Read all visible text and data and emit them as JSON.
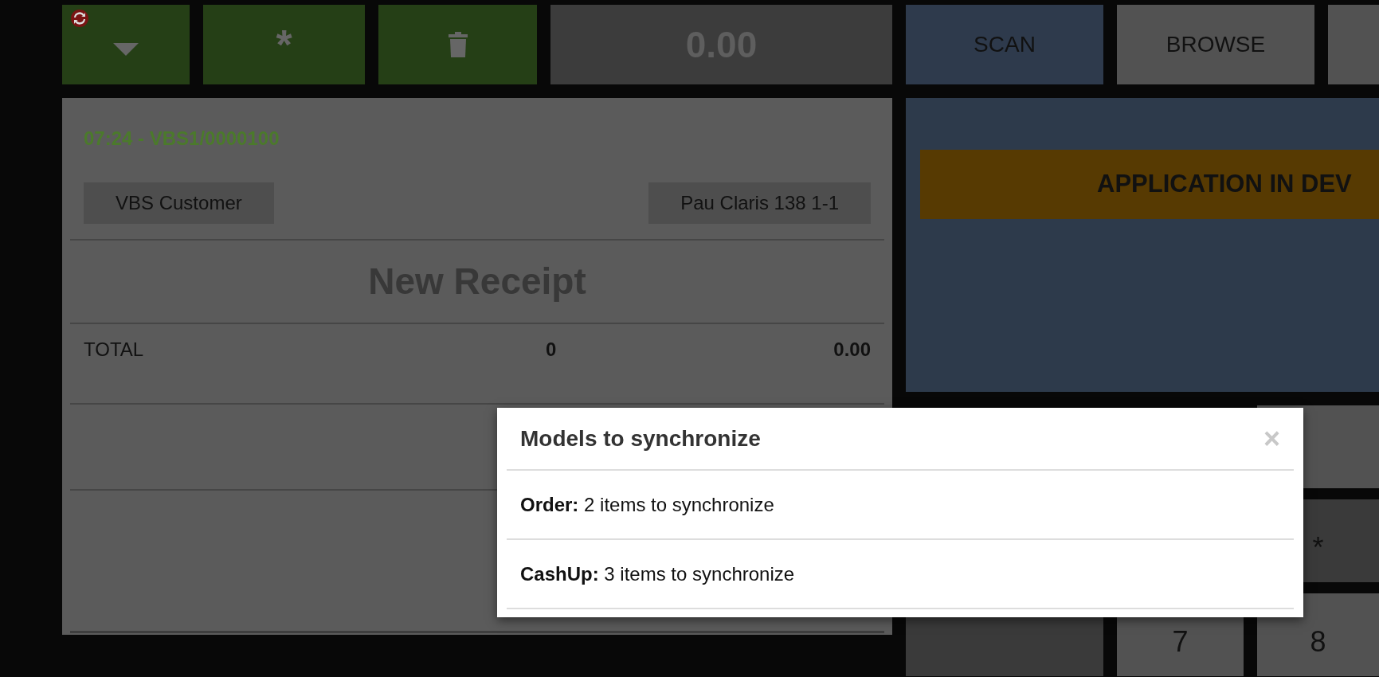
{
  "toolbar": {
    "buttons": [
      {
        "kind": "menu",
        "badge": true
      },
      {
        "kind": "text",
        "label": "*"
      },
      {
        "kind": "delete"
      }
    ],
    "total": "0.00"
  },
  "receipt": {
    "header": "07:24 - VBS1/0000100",
    "customer": "VBS Customer",
    "address": "Pau Claris 138 1-1",
    "title": "New Receipt",
    "total_row": {
      "label": "TOTAL",
      "quantity": "0",
      "amount": "0.00"
    }
  },
  "tabs": [
    {
      "label": "SCAN",
      "selected": true
    },
    {
      "label": "BROWSE",
      "selected": false
    },
    {
      "selected": false
    }
  ],
  "banner": "APPLICATION IN DEV",
  "keypad_rows": [
    [
      {
        "kind": "plain"
      }
    ],
    [
      {
        "kind": "dark",
        "label": "*"
      }
    ],
    [
      {
        "kind": "dark"
      },
      {
        "kind": "plain",
        "label": "7"
      },
      {
        "kind": "plain",
        "label": "8"
      }
    ]
  ],
  "modal": {
    "title": "Models to synchronize",
    "close": "×",
    "items": [
      "**Order:** 2 items to synchronize",
      "**CashUp:** 3 items to synchronize"
    ]
  }
}
